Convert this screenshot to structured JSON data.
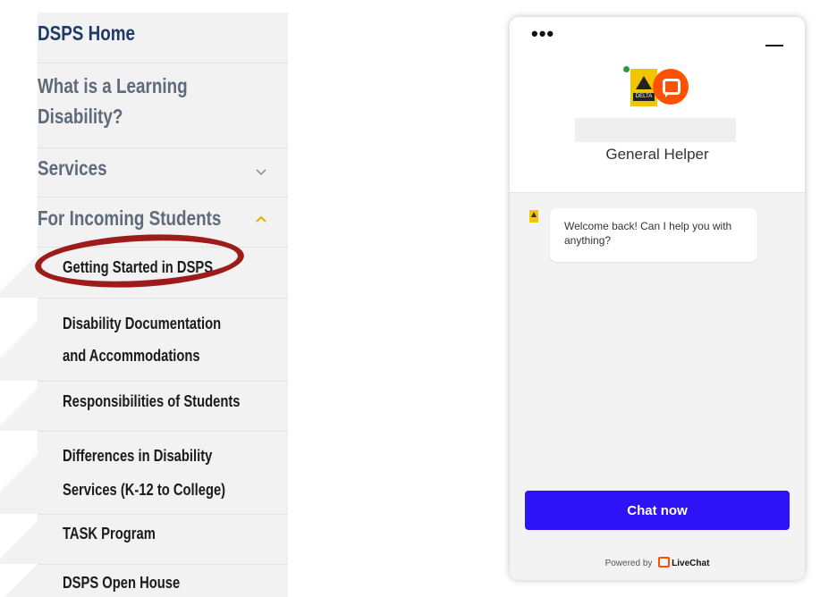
{
  "nav": {
    "home": "DSPS Home",
    "what_is": [
      "What is a Learning",
      "Disability?"
    ],
    "services": "Services",
    "incoming": "For Incoming Students",
    "sub_items": {
      "getting_started": "Getting Started in DSPS",
      "documentation": [
        "Disability Documentation",
        "and Accommodations"
      ],
      "responsibilities": "Responsibilities of Students",
      "differences": [
        "Differences in Disability",
        "Services (K-12 to College)"
      ],
      "task": "TASK Program",
      "open_house": "DSPS Open House"
    }
  },
  "chat": {
    "menu_icon": "more-dots-icon",
    "minimize_icon": "minimize-icon",
    "agent_label": "General Helper",
    "message": "Welcome back! Can I help you with anything?",
    "cta": "Chat now",
    "powered_by": "Powered by",
    "brand": "LiveChat",
    "brand_color": "#ff5100",
    "cta_color": "#2d13f5"
  },
  "colors": {
    "nav_top_text": "#1d3a6b",
    "highlight": "#9e1b1b",
    "delta_yellow": "#f2c500"
  }
}
